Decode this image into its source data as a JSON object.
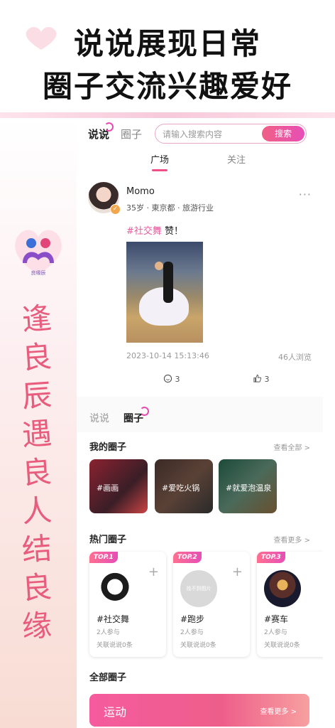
{
  "promo": {
    "line1": "说说展现日常",
    "line2": "圈子交流兴趣爱好",
    "vertical_slogan": [
      "逢",
      "良",
      "辰",
      "遇",
      "良",
      "人",
      "结",
      "良",
      "缘"
    ],
    "logo_text": "良缘辰"
  },
  "topbar": {
    "tab_active": "说说",
    "tab_inactive": "圈子",
    "search_placeholder": "请输入搜索内容",
    "search_button": "搜索"
  },
  "subtabs": {
    "tab1": "广场",
    "tab2": "关注"
  },
  "post": {
    "username": "Momo",
    "meta": "35岁 · 東京都 · 旅游行业",
    "tag": "#社交舞",
    "text": " 赞！",
    "time": "2023-10-14 15:13:46",
    "views": "46人浏览",
    "comments": "3",
    "likes": "3",
    "more": "···"
  },
  "section2": {
    "tab_inactive": "说说",
    "tab_active": "圈子",
    "my_circles_title": "我的圈子",
    "my_circles_more": "查看全部 >",
    "my_circles": [
      "#画画",
      "#爱吃火锅",
      "#就爱泡温泉"
    ],
    "hot_title": "热门圈子",
    "hot_more": "查看更多 >",
    "hot": [
      {
        "badge": "TOP.1",
        "name": "#社交舞",
        "join": "2人参与",
        "related": "关联说说0条"
      },
      {
        "badge": "TOP.2",
        "name": "#跑步",
        "join": "2人参与",
        "related": "关联说说0条",
        "img_text": "找不到图片"
      },
      {
        "badge": "TOP.3",
        "name": "#赛车",
        "join": "2人参与",
        "related": "关联说说0条"
      }
    ],
    "all_title": "全部圈子",
    "all_bar_label": "运动",
    "all_bar_more": "查看更多 >"
  }
}
